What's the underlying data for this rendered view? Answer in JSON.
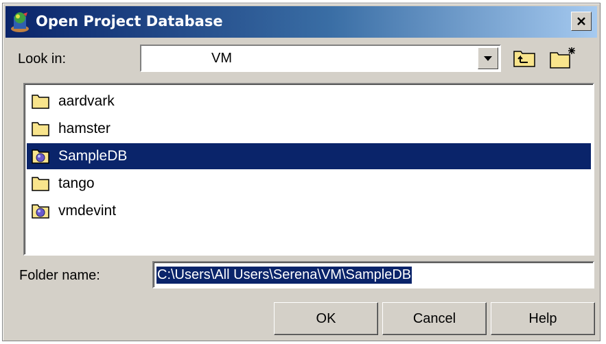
{
  "dialog": {
    "title": "Open Project Database",
    "close_label": "×"
  },
  "look_in": {
    "label": "Look in:",
    "value": "VM"
  },
  "toolbar": {
    "up_icon": "up-one-level-icon",
    "new_folder_icon": "new-folder-icon"
  },
  "files": [
    {
      "label": "aardvark",
      "icon": "folder-icon",
      "selected": false
    },
    {
      "label": "hamster",
      "icon": "folder-icon",
      "selected": false
    },
    {
      "label": "SampleDB",
      "icon": "database-folder-icon",
      "selected": true
    },
    {
      "label": "tango",
      "icon": "folder-icon",
      "selected": false
    },
    {
      "label": "vmdevint",
      "icon": "database-folder-icon",
      "selected": false
    }
  ],
  "folder_name": {
    "label": "Folder name:",
    "value": "C:\\Users\\All Users\\Serena\\VM\\SampleDB"
  },
  "buttons": {
    "ok": "OK",
    "cancel": "Cancel",
    "help": "Help"
  },
  "colors": {
    "selection": "#0a246a",
    "dialog_bg": "#d4d0c8",
    "title_gradient_start": "#0a246a",
    "title_gradient_end": "#a6caf0"
  }
}
